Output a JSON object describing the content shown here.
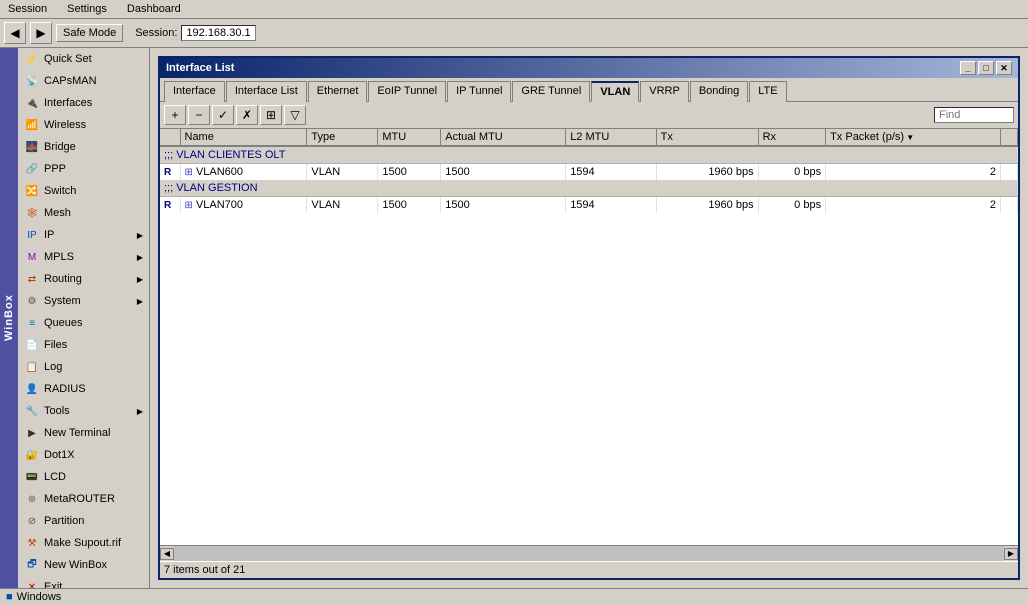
{
  "menubar": {
    "items": [
      "Session",
      "Settings",
      "Dashboard"
    ]
  },
  "toolbar": {
    "back_label": "◀",
    "forward_label": "▶",
    "safe_mode_label": "Safe Mode",
    "session_label": "Session:",
    "session_value": "192.168.30.1"
  },
  "sidebar": {
    "items": [
      {
        "id": "quick-set",
        "label": "Quick Set",
        "icon": "quick",
        "has_sub": false
      },
      {
        "id": "capsman",
        "label": "CAPsMAN",
        "icon": "capsman",
        "has_sub": false
      },
      {
        "id": "interfaces",
        "label": "Interfaces",
        "icon": "interfaces",
        "has_sub": false
      },
      {
        "id": "wireless",
        "label": "Wireless",
        "icon": "wireless",
        "has_sub": false
      },
      {
        "id": "bridge",
        "label": "Bridge",
        "icon": "bridge",
        "has_sub": false
      },
      {
        "id": "ppp",
        "label": "PPP",
        "icon": "ppp",
        "has_sub": false
      },
      {
        "id": "switch",
        "label": "Switch",
        "icon": "switch",
        "has_sub": false
      },
      {
        "id": "mesh",
        "label": "Mesh",
        "icon": "mesh",
        "has_sub": false
      },
      {
        "id": "ip",
        "label": "IP",
        "icon": "ip",
        "has_sub": true
      },
      {
        "id": "mpls",
        "label": "MPLS",
        "icon": "mpls",
        "has_sub": true
      },
      {
        "id": "routing",
        "label": "Routing",
        "icon": "routing",
        "has_sub": true
      },
      {
        "id": "system",
        "label": "System",
        "icon": "system",
        "has_sub": true
      },
      {
        "id": "queues",
        "label": "Queues",
        "icon": "queues",
        "has_sub": false
      },
      {
        "id": "files",
        "label": "Files",
        "icon": "files",
        "has_sub": false
      },
      {
        "id": "log",
        "label": "Log",
        "icon": "log",
        "has_sub": false
      },
      {
        "id": "radius",
        "label": "RADIUS",
        "icon": "radius",
        "has_sub": false
      },
      {
        "id": "tools",
        "label": "Tools",
        "icon": "tools",
        "has_sub": true
      },
      {
        "id": "new-terminal",
        "label": "New Terminal",
        "icon": "terminal",
        "has_sub": false
      },
      {
        "id": "dot1x",
        "label": "Dot1X",
        "icon": "dot1x",
        "has_sub": false
      },
      {
        "id": "lcd",
        "label": "LCD",
        "icon": "lcd",
        "has_sub": false
      },
      {
        "id": "metarouter",
        "label": "MetaROUTER",
        "icon": "meta",
        "has_sub": false
      },
      {
        "id": "partition",
        "label": "Partition",
        "icon": "partition",
        "has_sub": false
      },
      {
        "id": "make-supout",
        "label": "Make Supout.rif",
        "icon": "make",
        "has_sub": false
      },
      {
        "id": "new-winbox",
        "label": "New WinBox",
        "icon": "newwin",
        "has_sub": false
      },
      {
        "id": "exit",
        "label": "Exit",
        "icon": "exit",
        "has_sub": false
      }
    ],
    "windows_label": "Windows"
  },
  "winbox_label": "WinBox",
  "window": {
    "title": "Interface List",
    "tabs": [
      {
        "id": "interface",
        "label": "Interface",
        "active": false
      },
      {
        "id": "interface-list",
        "label": "Interface List",
        "active": false
      },
      {
        "id": "ethernet",
        "label": "Ethernet",
        "active": false
      },
      {
        "id": "eoip-tunnel",
        "label": "EoIP Tunnel",
        "active": false
      },
      {
        "id": "ip-tunnel",
        "label": "IP Tunnel",
        "active": false
      },
      {
        "id": "gre-tunnel",
        "label": "GRE Tunnel",
        "active": false
      },
      {
        "id": "vlan",
        "label": "VLAN",
        "active": true
      },
      {
        "id": "vrrp",
        "label": "VRRP",
        "active": false
      },
      {
        "id": "bonding",
        "label": "Bonding",
        "active": false
      },
      {
        "id": "lte",
        "label": "LTE",
        "active": false
      }
    ],
    "table_toolbar": {
      "add": "+",
      "remove": "−",
      "enable": "✓",
      "disable": "✗",
      "copy": "⊞",
      "filter": "⊟",
      "find_placeholder": "Find"
    },
    "columns": [
      "",
      "Name",
      "Type",
      "MTU",
      "Actual MTU",
      "L2 MTU",
      "Tx",
      "Rx",
      "Tx Packet (p/s)",
      ""
    ],
    "groups": [
      {
        "id": "group-clientes",
        "label": ";;; VLAN CLIENTES OLT",
        "rows": [
          {
            "flag": "R",
            "name": "VLAN600",
            "type": "VLAN",
            "mtu": "1500",
            "actual_mtu": "1500",
            "l2_mtu": "1594",
            "tx": "1960 bps",
            "rx": "0 bps",
            "tx_packet": "2"
          }
        ]
      },
      {
        "id": "group-gestion",
        "label": ";;; VLAN GESTION",
        "rows": [
          {
            "flag": "R",
            "name": "VLAN700",
            "type": "VLAN",
            "mtu": "1500",
            "actual_mtu": "1500",
            "l2_mtu": "1594",
            "tx": "1960 bps",
            "rx": "0 bps",
            "tx_packet": "2"
          }
        ]
      }
    ],
    "status": "7 items out of 21"
  }
}
